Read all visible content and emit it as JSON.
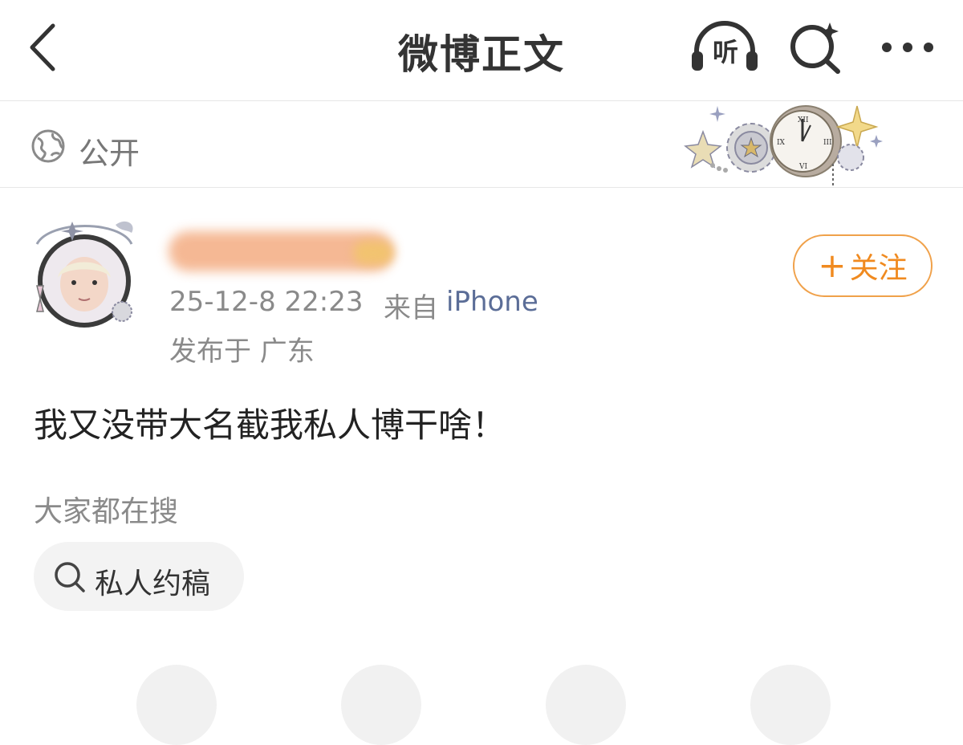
{
  "header": {
    "title": "微博正文",
    "listen_label": "听",
    "icons": [
      "back-arrow-icon",
      "headphones-icon",
      "ai-search-icon",
      "more-icon"
    ]
  },
  "visibility": {
    "label": "公开",
    "icon": "globe-icon"
  },
  "author": {
    "timestamp": "25-12-8 22:23",
    "source_prefix": "来自",
    "device": "iPhone",
    "location": "发布于 广东",
    "follow_label": "关注"
  },
  "post": {
    "text": "我又没带大名截我私人博干啥！"
  },
  "hot_search": {
    "label": "大家都在搜",
    "chips": [
      {
        "text": "私人约稿"
      }
    ]
  },
  "colors": {
    "accent": "#f08a1f",
    "link": "#5b6d97",
    "muted": "#8a8a8a"
  }
}
